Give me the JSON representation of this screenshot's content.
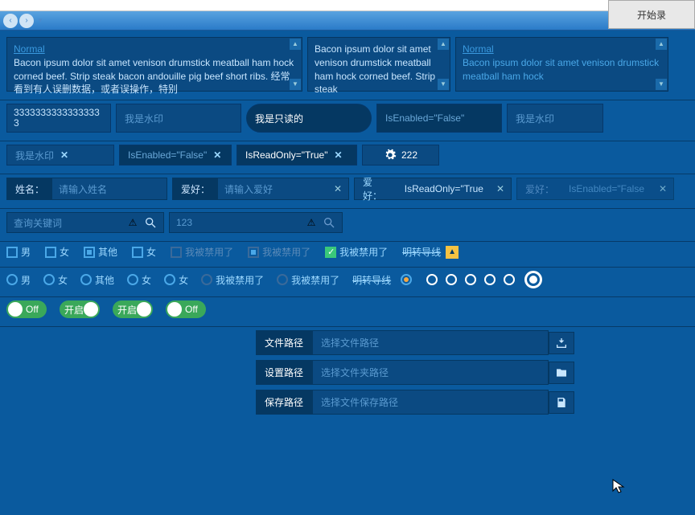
{
  "header": {
    "start_button": "开始录"
  },
  "panels": {
    "p1": {
      "title": "Normal",
      "text": "Bacon ipsum dolor sit amet venison drumstick meatball ham hock corned beef. Strip steak bacon andouille pig beef short ribs. 经常看到有人误删数据，或者误操作，特别"
    },
    "p2": {
      "text": "Bacon ipsum dolor sit amet venison drumstick meatball ham hock corned beef. Strip steak"
    },
    "p3": {
      "title": "Normal",
      "text": "Bacon ipsum dolor sit amet venison drumstick meatball ham hock"
    }
  },
  "row2": {
    "box1": "33333333333333333",
    "box2_placeholder": "我是水印",
    "box3": "我是只读的",
    "box4": "IsEnabled=\"False\"",
    "box5_placeholder": "我是水印"
  },
  "row3": {
    "box1_placeholder": "我是水印",
    "box2": "IsEnabled=\"False\"",
    "box3": "IsReadOnly=\"True\"",
    "box4": "222"
  },
  "row4": {
    "label_name": "姓名：",
    "name_placeholder": "请输入姓名",
    "label_hobby": "爱好：",
    "hobby_placeholder": "请输入爱好",
    "label_hobby2": "爱好：",
    "hobby2_value": "IsReadOnly=\"True",
    "label_hobby3": "爱好：",
    "hobby3_value": "IsEnabled=\"False"
  },
  "row5": {
    "search_placeholder": "查询关键词",
    "search2_value": "123"
  },
  "checks": {
    "male": "男",
    "female": "女",
    "other": "其他",
    "female2": "女",
    "disabled1": "我被禁用了",
    "disabled2": "我被禁用了",
    "disabled3": "我被禁用了",
    "err": "明转导线"
  },
  "radios": {
    "male": "男",
    "female": "女",
    "other": "其他",
    "female2": "女",
    "female3": "女",
    "disabled1": "我被禁用了",
    "disabled2": "我被禁用了",
    "err": "明转导线"
  },
  "toggles": {
    "off": "Off",
    "on1": "开启",
    "on2": "开启",
    "off2": "Off"
  },
  "paths": {
    "file_label": "文件路径",
    "file_placeholder": "选择文件路径",
    "folder_label": "设置路径",
    "folder_placeholder": "选择文件夹路径",
    "save_label": "保存路径",
    "save_placeholder": "选择文件保存路径"
  }
}
